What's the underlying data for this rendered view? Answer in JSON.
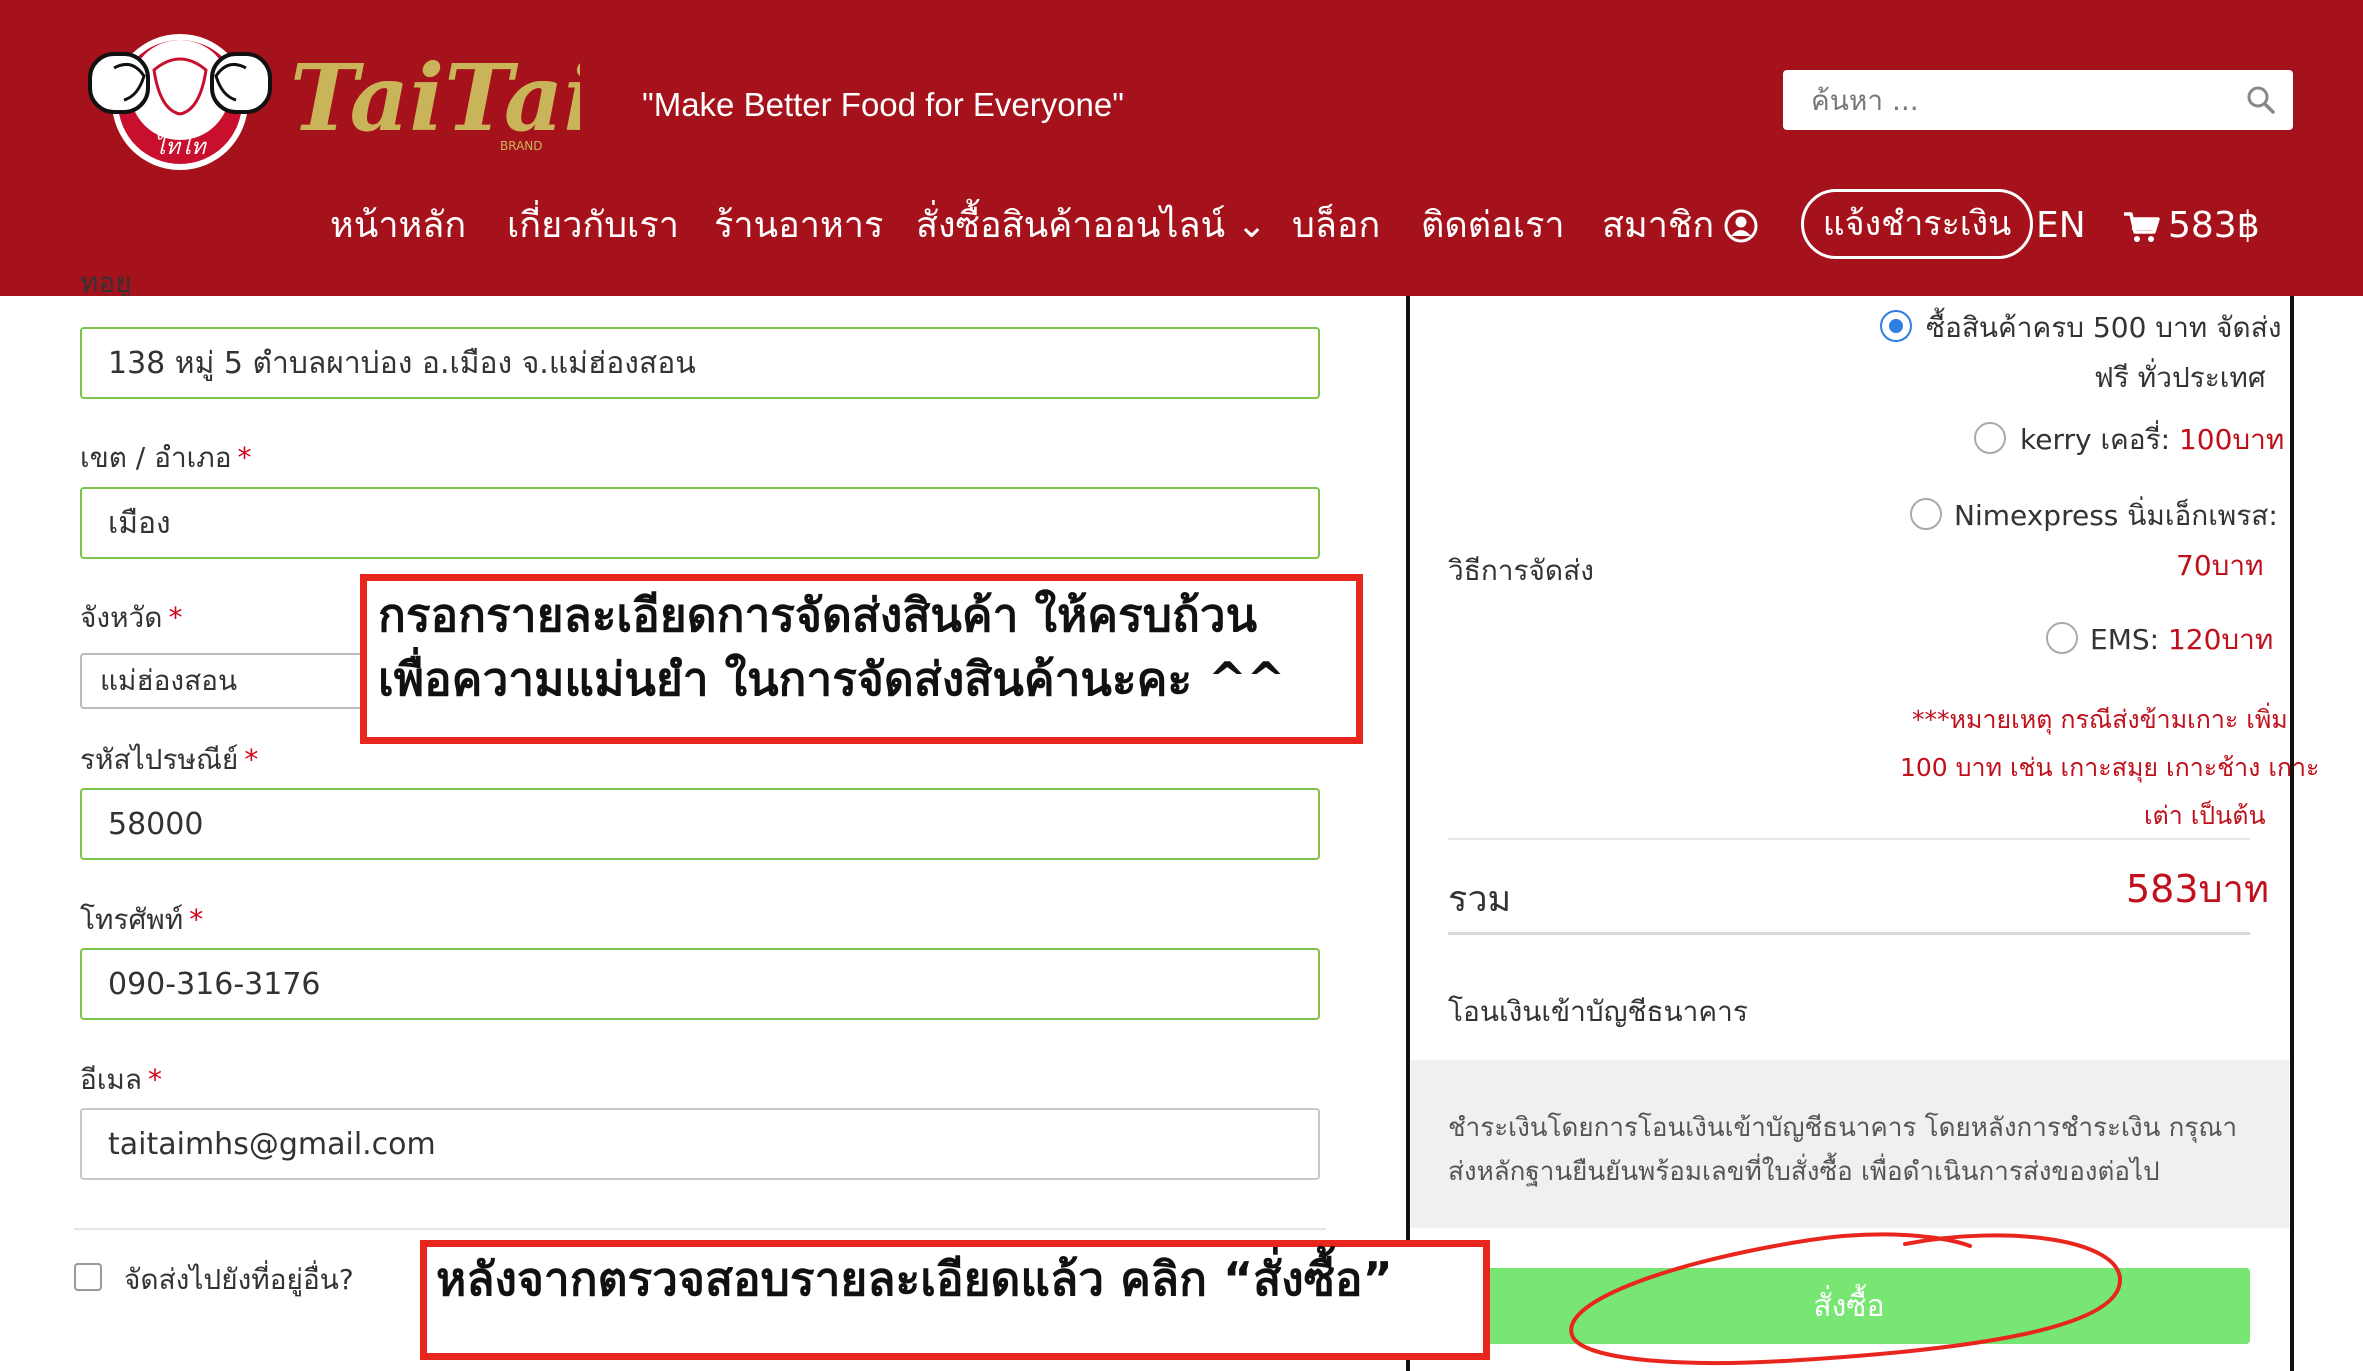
{
  "header": {
    "logo_text": "ไทไท",
    "brand_name": "TaiTai",
    "brand_sub": "BRAND",
    "tagline": "\"Make Better Food for Everyone\"",
    "bg_color": "#a5121b",
    "search": {
      "placeholder": "ค้นหา ...",
      "icon": "search-icon"
    }
  },
  "nav": {
    "items": [
      "หน้าหลัก",
      "เกี่ยวกับเรา",
      "ร้านอาหาร",
      "สั่งซื้อสินค้าออนไลน์ ⌄",
      "บล็อก",
      "ติดต่อเรา",
      "สมาชิก"
    ],
    "payment_button": "แจ้งชำระเงิน",
    "language": "EN",
    "cart_total": "583฿"
  },
  "form": {
    "address_label": "ที่อยู่",
    "address_value": "138 หมู่ 5 ตำบลผาบ่อง อ.เมือง จ.แม่ฮ่องสอน",
    "district_label": "เขต / อำเภอ",
    "district_value": "เมือง",
    "province_label": "จังหวัด",
    "province_value": "แม่ฮ่องสอน",
    "postcode_label": "รหัสไปรษณีย์",
    "postcode_value": "58000",
    "phone_label": "โทรศัพท์",
    "phone_value": "090-316-3176",
    "email_label": "อีเมล",
    "email_value": "taitaimhs@gmail.com",
    "required_mark": "*",
    "ship_elsewhere_label": "จัดส่งไปยังที่อยู่อื่น?"
  },
  "summary": {
    "shipping_label": "วิธีการจัดส่ง",
    "shipping_options": [
      {
        "line1": "ซื้อสินค้าครบ 500 บาท จัดส่ง",
        "line2": "ฟรี ทั่วประเทศ",
        "selected": true
      },
      {
        "name": "kerry เคอรี่: ",
        "price": "100บาท",
        "selected": false
      },
      {
        "name": "Nimexpress นิ่มเอ็กเพรส:",
        "price": "70บาท",
        "selected": false
      },
      {
        "name": "EMS: ",
        "price": "120บาท",
        "selected": false
      }
    ],
    "note_lines": [
      "***หมายเหตุ กรณีส่งข้ามเกาะ เพิ่ม",
      "100 บาท เช่น เกาะสมุย เกาะช้าง เกาะ",
      "เต่า เป็นต้น"
    ],
    "total_label": "รวม",
    "total_value": "583บาท",
    "payment_method": "โอนเงินเข้าบัญชีธนาคาร",
    "payment_desc": "ชำระเงินโดยการโอนเงินเข้าบัญชีธนาคาร โดยหลังการชำระเงิน กรุณาส่งหลักฐานยืนยันพร้อมเลขที่ใบสั่งซื้อ เพื่อดำเนินการส่งของต่อไป",
    "order_button": "สั่งซื้อ",
    "accent_color": "#78e672",
    "price_color": "#c0101b"
  },
  "annotations": {
    "top_line1": "กรอกรายละเอียดการจัดส่งสินค้า ให้ครบถ้วน",
    "top_line2": "เพื่อความแม่นยำ ในการจัดส่งสินค้านะคะ ^^",
    "bottom": "หลังจากตรวจสอบรายละเอียดแล้ว คลิก “สั่งซื้อ”",
    "color": "#e8261e"
  }
}
